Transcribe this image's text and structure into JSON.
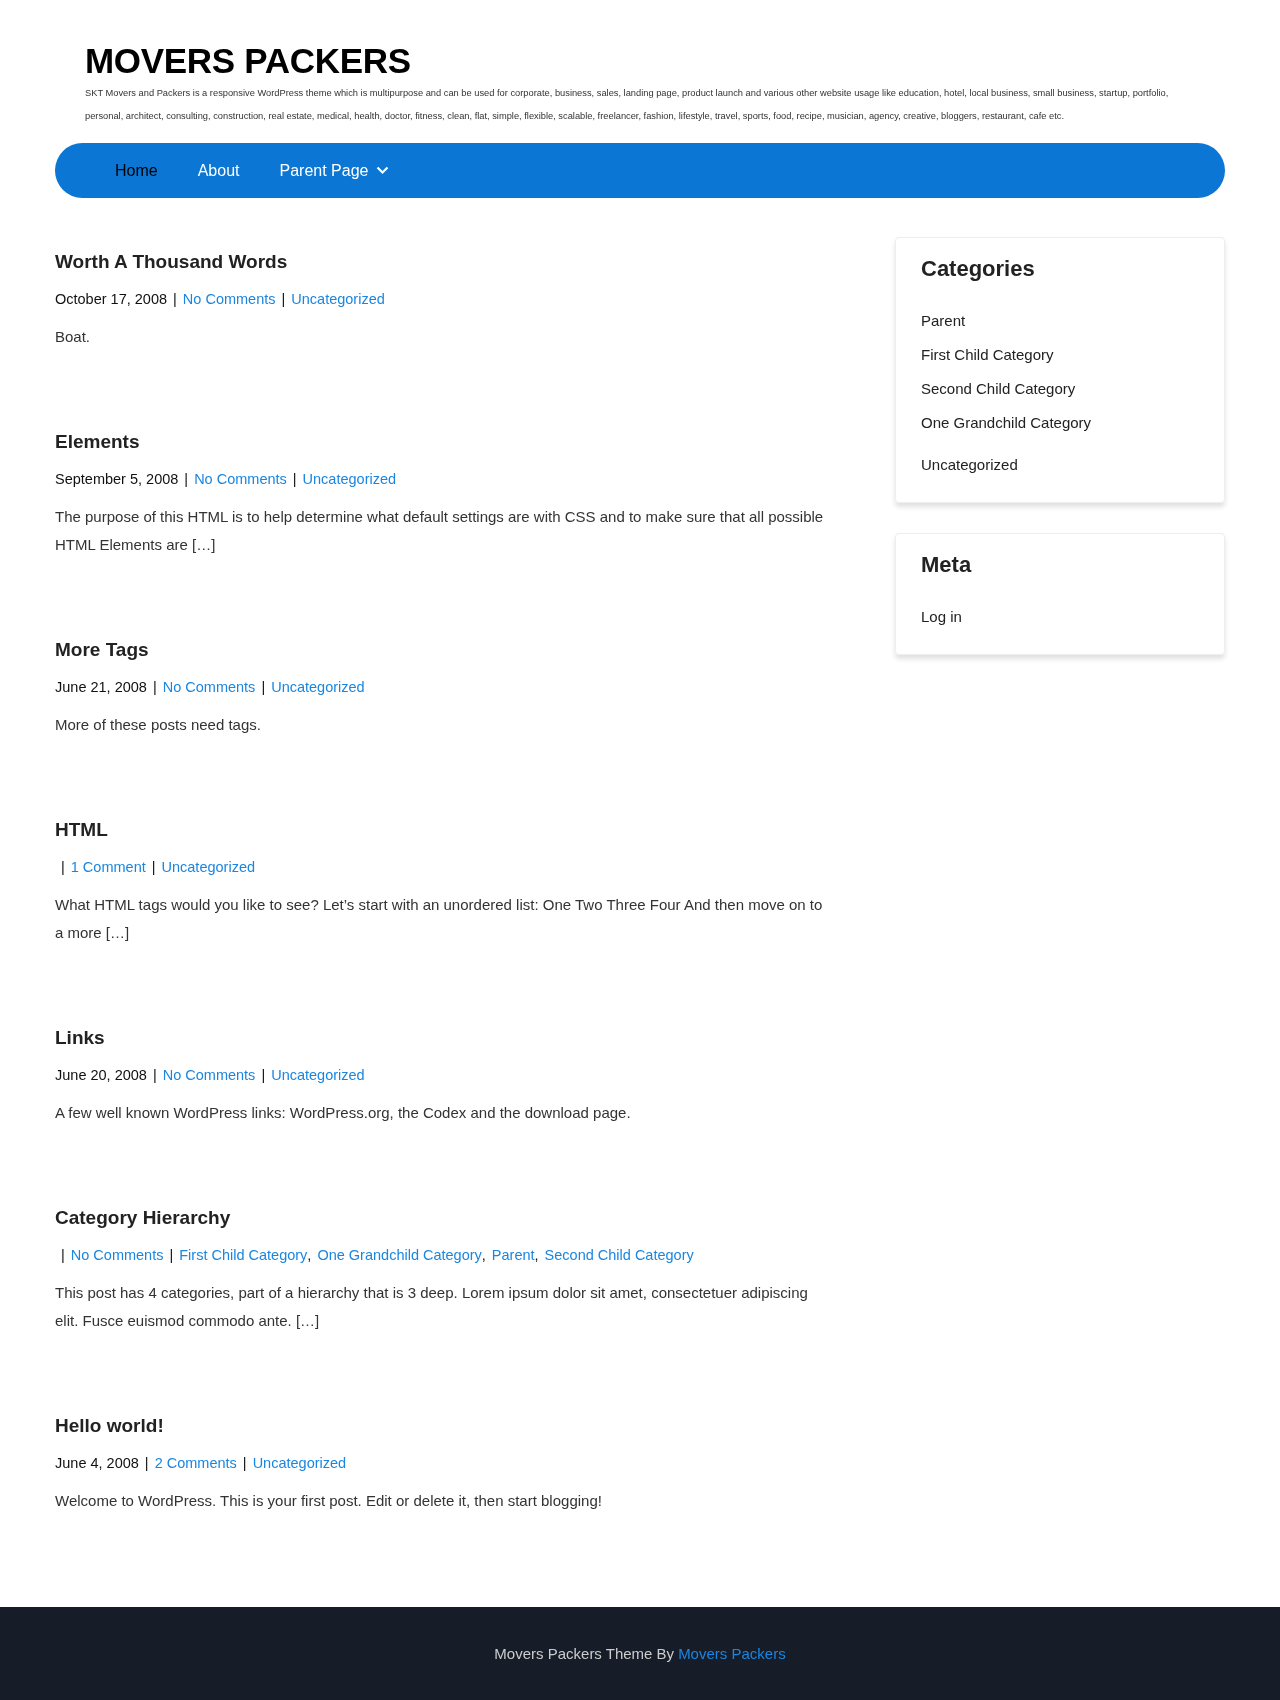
{
  "site": {
    "title": "MOVERS PACKERS",
    "description": "SKT Movers and Packers is a responsive WordPress theme which is multipurpose and can be used for corporate, business, sales, landing page, product launch and various other website usage like education, hotel, local business, small business, startup, portfolio, personal, architect, consulting, construction, real estate, medical, health, doctor, fitness, clean, flat, simple, flexible, scalable, freelancer, fashion, lifestyle, travel, sports, food, recipe, musician, agency, creative, bloggers, restaurant, cafe etc."
  },
  "nav": [
    {
      "label": "Home",
      "selected": true
    },
    {
      "label": "About",
      "selected": false
    },
    {
      "label": "Parent Page",
      "selected": false,
      "has_submenu": true
    }
  ],
  "posts": [
    {
      "title": "Worth A Thousand Words",
      "meta": [
        {
          "kind": "date",
          "text": "October 17, 2008"
        },
        {
          "kind": "sep",
          "text": "|"
        },
        {
          "kind": "link",
          "text": "No Comments"
        },
        {
          "kind": "sep",
          "text": "|"
        },
        {
          "kind": "link",
          "text": "Uncategorized"
        }
      ],
      "excerpt": "Boat."
    },
    {
      "title": "Elements",
      "meta": [
        {
          "kind": "date",
          "text": "September 5, 2008"
        },
        {
          "kind": "sep",
          "text": "|"
        },
        {
          "kind": "link",
          "text": "No Comments"
        },
        {
          "kind": "sep",
          "text": "|"
        },
        {
          "kind": "link",
          "text": "Uncategorized"
        }
      ],
      "excerpt": "The purpose of this HTML is to help determine what default settings are with CSS and to make sure that all possible HTML Elements are […]"
    },
    {
      "title": "More Tags",
      "meta": [
        {
          "kind": "date",
          "text": "June 21, 2008"
        },
        {
          "kind": "sep",
          "text": "|"
        },
        {
          "kind": "link",
          "text": "No Comments"
        },
        {
          "kind": "sep",
          "text": "|"
        },
        {
          "kind": "link",
          "text": "Uncategorized"
        }
      ],
      "excerpt": "More of these posts need tags."
    },
    {
      "title": "HTML",
      "meta": [
        {
          "kind": "sep",
          "text": "|"
        },
        {
          "kind": "link",
          "text": "1 Comment"
        },
        {
          "kind": "sep",
          "text": "|"
        },
        {
          "kind": "link",
          "text": "Uncategorized"
        }
      ],
      "excerpt": "What HTML tags would you like to see? Let’s start with an unordered list: One Two Three Four And then move on to a more […]"
    },
    {
      "title": "Links",
      "meta": [
        {
          "kind": "date",
          "text": "June 20, 2008"
        },
        {
          "kind": "sep",
          "text": "|"
        },
        {
          "kind": "link",
          "text": "No Comments"
        },
        {
          "kind": "sep",
          "text": "|"
        },
        {
          "kind": "link",
          "text": "Uncategorized"
        }
      ],
      "excerpt": "A few well known WordPress links: WordPress.org, the Codex and the download page."
    },
    {
      "title": "Category Hierarchy",
      "meta": [
        {
          "kind": "sep",
          "text": "|"
        },
        {
          "kind": "link",
          "text": "No Comments"
        },
        {
          "kind": "sep",
          "text": "|"
        },
        {
          "kind": "link",
          "text": "First Child Category"
        },
        {
          "kind": "comma",
          "text": ","
        },
        {
          "kind": "link",
          "text": "One Grandchild Category"
        },
        {
          "kind": "comma",
          "text": ","
        },
        {
          "kind": "link",
          "text": "Parent"
        },
        {
          "kind": "comma",
          "text": ","
        },
        {
          "kind": "link",
          "text": "Second Child Category"
        }
      ],
      "excerpt": "This post has 4 categories, part of a hierarchy that is 3 deep. Lorem ipsum dolor sit amet, consectetuer adipiscing elit. Fusce euismod commodo ante. […]"
    },
    {
      "title": "Hello world!",
      "meta": [
        {
          "kind": "date",
          "text": "June 4, 2008"
        },
        {
          "kind": "sep",
          "text": "|"
        },
        {
          "kind": "link",
          "text": "2 Comments"
        },
        {
          "kind": "sep",
          "text": "|"
        },
        {
          "kind": "link",
          "text": "Uncategorized"
        }
      ],
      "excerpt": "Welcome to WordPress. This is your first post. Edit or delete it, then start blogging!"
    }
  ],
  "sidebar": [
    {
      "title": "Categories",
      "items": [
        {
          "label": "Parent",
          "children": [
            {
              "label": "First Child Category"
            },
            {
              "label": "Second Child Category",
              "children": [
                {
                  "label": "One Grandchild Category"
                }
              ]
            }
          ]
        },
        {
          "label": "Uncategorized"
        }
      ]
    },
    {
      "title": "Meta",
      "items": [
        {
          "label": "Log in"
        }
      ]
    }
  ],
  "footer": {
    "text": "Movers Packers Theme By",
    "link": "Movers Packers"
  }
}
